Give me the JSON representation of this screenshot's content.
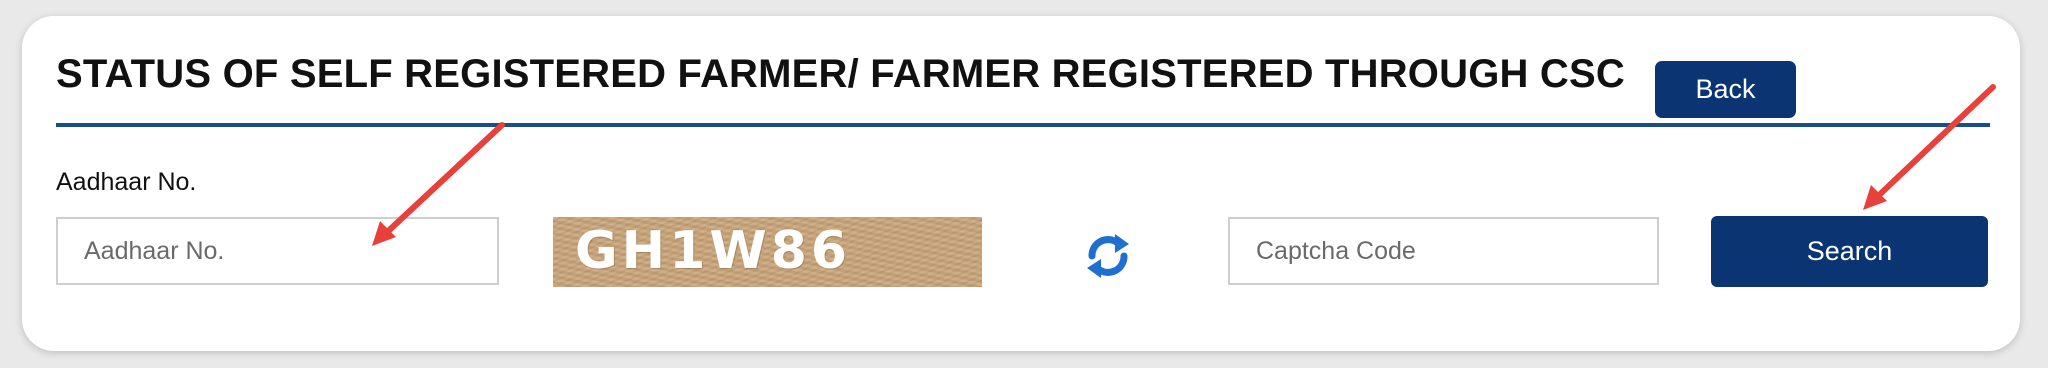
{
  "page": {
    "title": "STATUS OF SELF REGISTERED FARMER/ FARMER REGISTERED THROUGH CSC",
    "back_label": "Back"
  },
  "form": {
    "aadhaar_label": "Aadhaar No.",
    "aadhaar_value": "",
    "aadhaar_placeholder": "Aadhaar No.",
    "captcha_image_text": "GH1W86",
    "refresh_icon": "refresh-icon",
    "captcha_value": "",
    "captcha_placeholder": "Captcha Code",
    "search_label": "Search"
  },
  "colors": {
    "primary": "#0b3572",
    "divider": "#1a4f86",
    "annotation_arrow": "#e8403a",
    "refresh_icon": "#1f6fd1",
    "captcha_bg": "#c9a57a"
  },
  "annotations": {
    "arrows": [
      "arrow-to-aadhaar-input",
      "arrow-to-search-button"
    ]
  }
}
